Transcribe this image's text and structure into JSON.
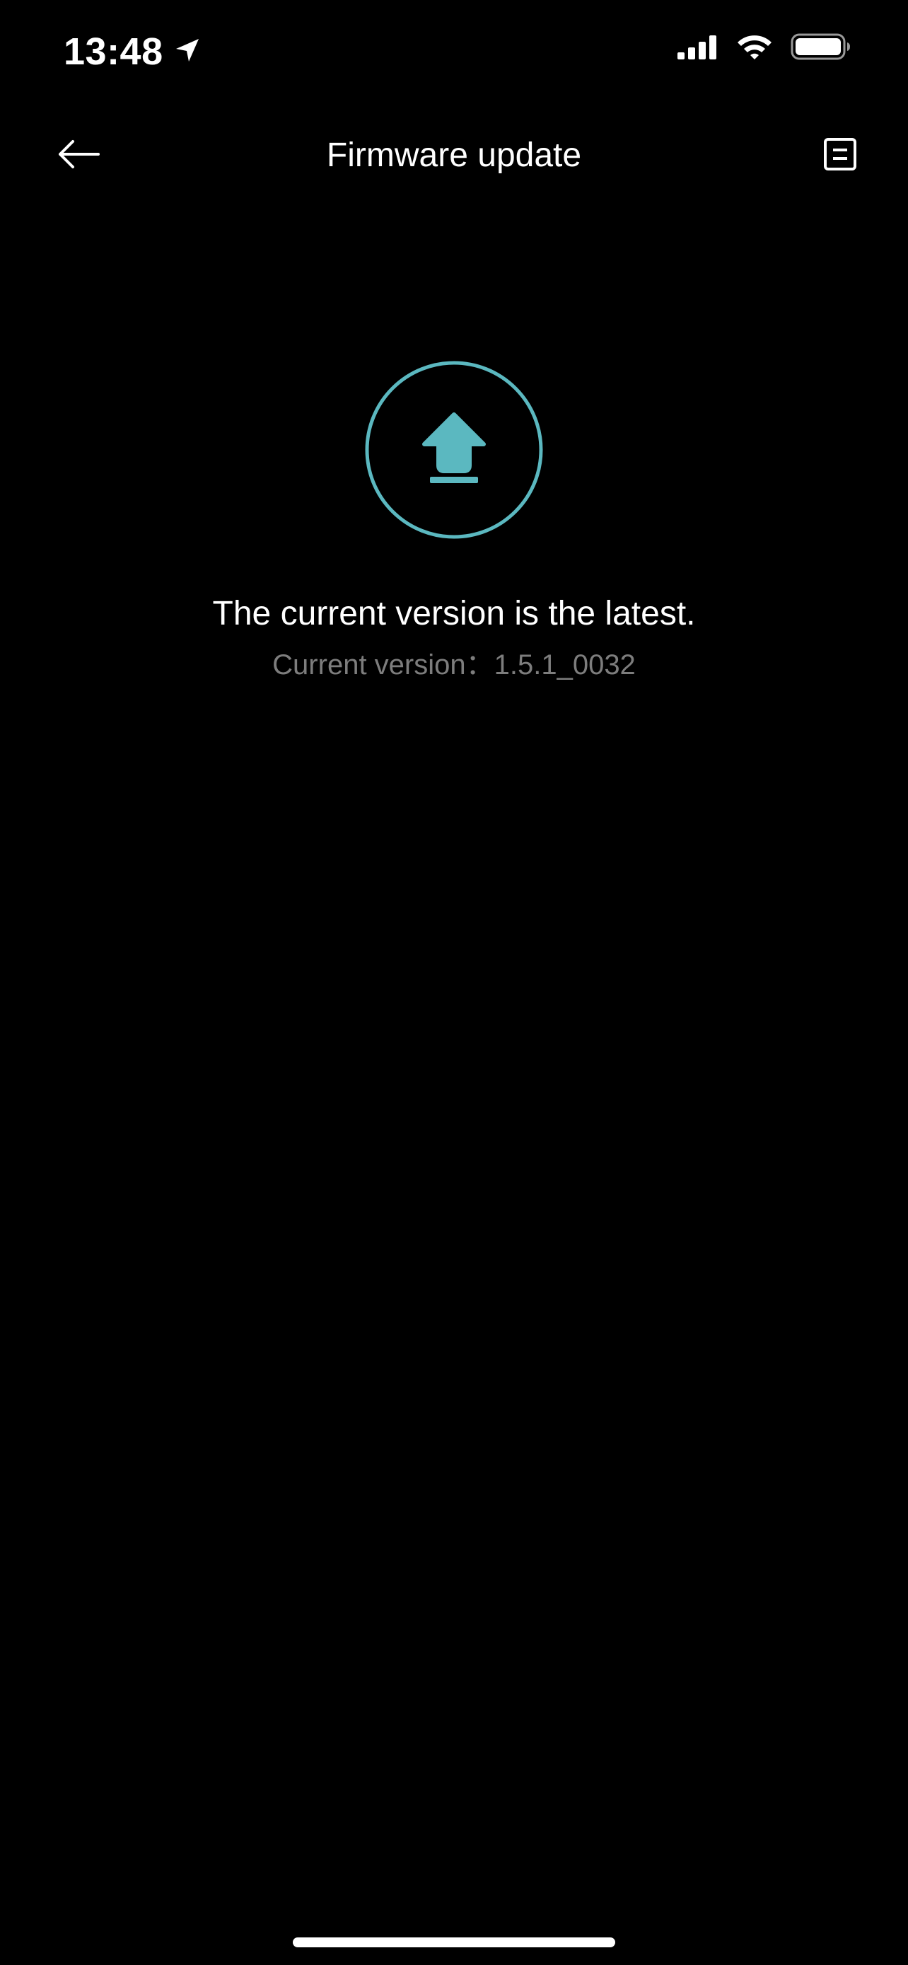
{
  "status_bar": {
    "time": "13:48",
    "location_icon": "location-arrow-icon",
    "signal_icon": "cellular-signal-icon",
    "wifi_icon": "wifi-icon",
    "battery_icon": "battery-icon"
  },
  "nav": {
    "title": "Firmware update",
    "back_icon": "back-arrow-icon",
    "menu_icon": "log-list-icon"
  },
  "main": {
    "badge_icon": "upload-arrow-icon",
    "status_message": "The current version is the latest.",
    "version_label": "Current version：",
    "version_value": "1.5.1_0032"
  },
  "colors": {
    "background": "#000000",
    "accent": "#5bb8c0",
    "primary_text": "#ffffff",
    "secondary_text": "#7d7d7d"
  }
}
